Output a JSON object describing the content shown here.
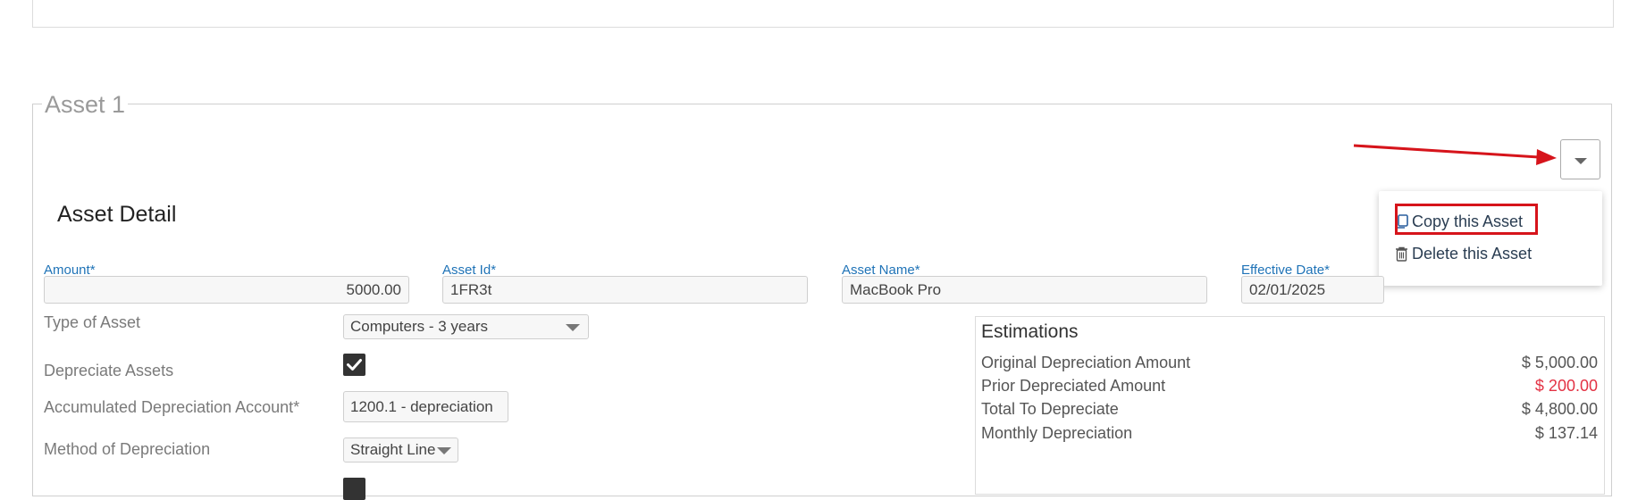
{
  "fieldset": {
    "legend": "Asset 1"
  },
  "section": {
    "title": "Asset Detail"
  },
  "actions_menu": {
    "copy_label": "Copy this Asset",
    "delete_label": "Delete this Asset"
  },
  "fields": {
    "amount": {
      "label": "Amount*",
      "value": "5000.00"
    },
    "asset_id": {
      "label": "Asset Id*",
      "value": "1FR3t"
    },
    "asset_name": {
      "label": "Asset Name*",
      "value": "MacBook Pro"
    },
    "effective_date": {
      "label": "Effective Date*",
      "value": "02/01/2025"
    }
  },
  "details": {
    "type_of_asset": {
      "label": "Type of Asset",
      "value": "Computers - 3 years"
    },
    "depreciate_assets": {
      "label": "Depreciate Assets",
      "checked": true
    },
    "accumulated_account": {
      "label": "Accumulated Depreciation Account*",
      "value": "1200.1 - depreciation"
    },
    "method": {
      "label": "Method of Depreciation",
      "value": "Straight Line"
    }
  },
  "estimations": {
    "title": "Estimations",
    "rows": [
      {
        "label": "Original Depreciation Amount",
        "value": "$ 5,000.00"
      },
      {
        "label": "Prior Depreciated Amount",
        "value": "$ 200.00"
      },
      {
        "label": "Total To Depreciate",
        "value": "$ 4,800.00"
      },
      {
        "label": "Monthly Depreciation",
        "value": "$ 137.14"
      }
    ]
  },
  "colors": {
    "accent_label": "#1f73b7",
    "highlight_red": "#d6141b",
    "negative_value": "#e33244"
  }
}
